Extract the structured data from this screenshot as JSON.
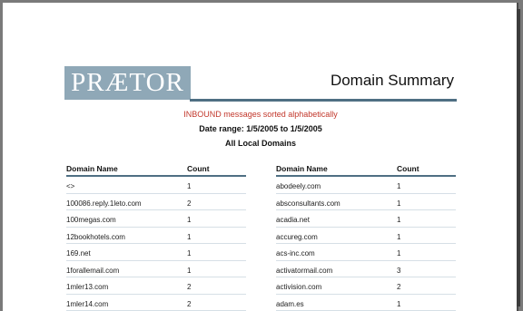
{
  "report": {
    "logo_text": "PRÆTOR",
    "title": "Domain Summary",
    "subtitle": "INBOUND messages sorted alphabetically",
    "date_range": "Date range: 1/5/2005 to 1/5/2005",
    "scope": "All Local Domains"
  },
  "tables": {
    "left": {
      "headers": [
        "Domain Name",
        "Count"
      ],
      "rows": [
        [
          "<>",
          "1"
        ],
        [
          "100086.reply.1leto.com",
          "2"
        ],
        [
          "100megas.com",
          "1"
        ],
        [
          "12bookhotels.com",
          "1"
        ],
        [
          "169.net",
          "1"
        ],
        [
          "1forallemail.com",
          "1"
        ],
        [
          "1mler13.com",
          "2"
        ],
        [
          "1mler14.com",
          "2"
        ]
      ]
    },
    "right": {
      "headers": [
        "Domain Name",
        "Count"
      ],
      "rows": [
        [
          "abodeely.com",
          "1"
        ],
        [
          "absconsultants.com",
          "1"
        ],
        [
          "acadia.net",
          "1"
        ],
        [
          "accureg.com",
          "1"
        ],
        [
          "acs-inc.com",
          "1"
        ],
        [
          "activatormail.com",
          "3"
        ],
        [
          "activision.com",
          "2"
        ],
        [
          "adam.es",
          "1"
        ]
      ]
    }
  }
}
